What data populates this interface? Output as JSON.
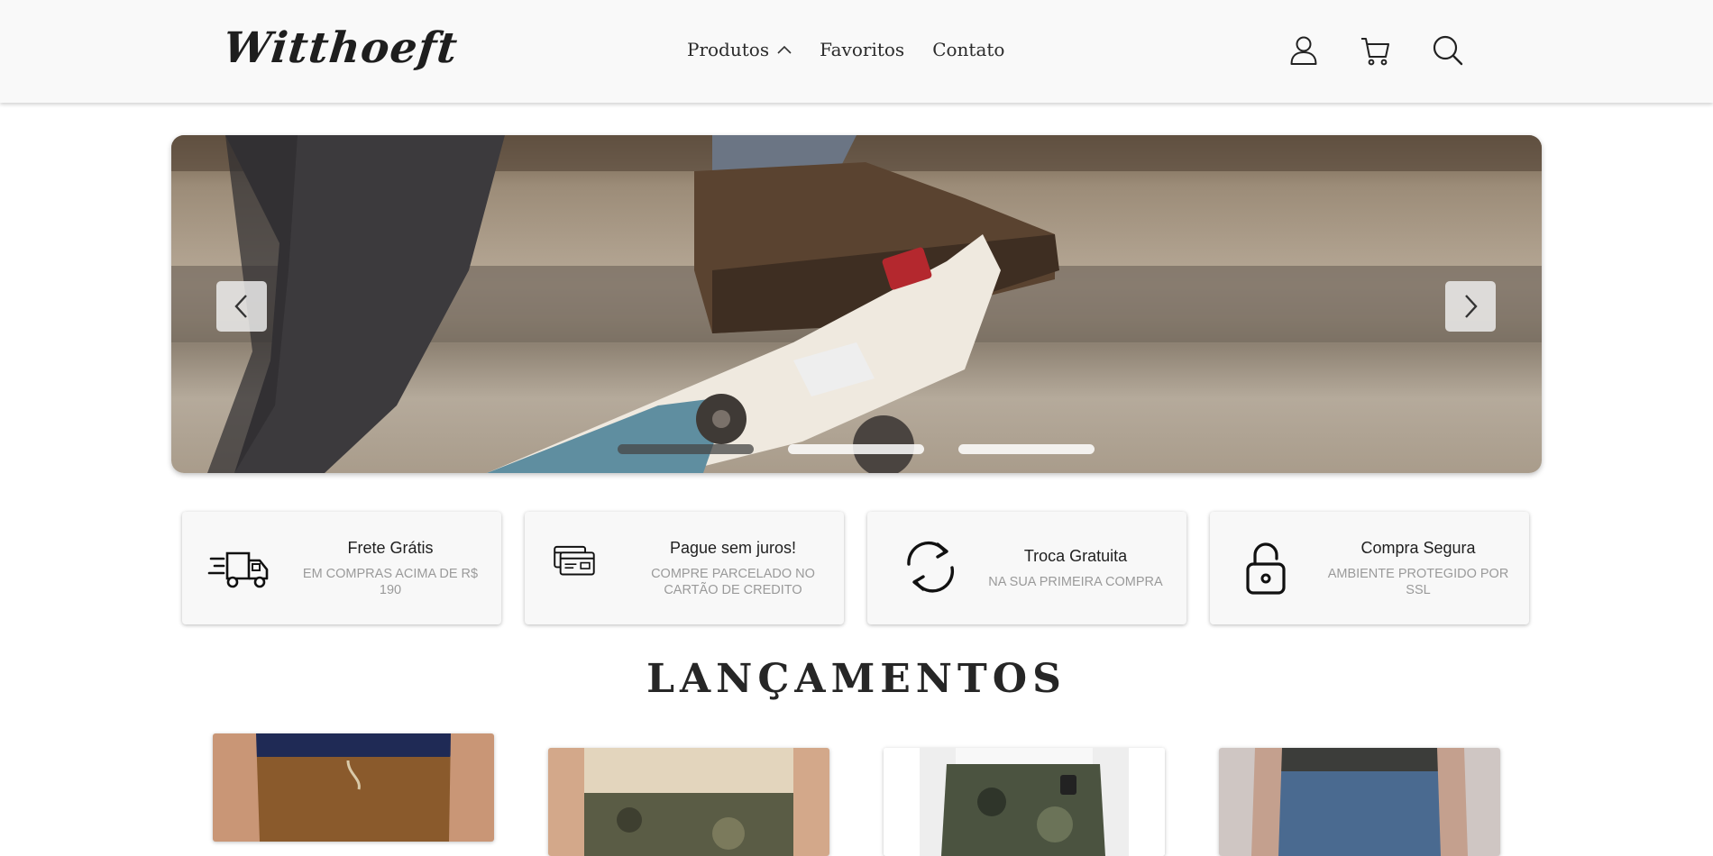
{
  "header": {
    "logo": "Witthoeft",
    "nav": [
      {
        "label": "Produtos",
        "icon": "chevron-up-icon"
      },
      {
        "label": "Favoritos"
      },
      {
        "label": "Contato"
      }
    ],
    "icons": [
      "user-icon",
      "cart-icon",
      "search-icon"
    ]
  },
  "carousel": {
    "image": "skateboarder-photo",
    "prev_icon": "chevron-left-icon",
    "next_icon": "chevron-right-icon",
    "indicator_count": 3,
    "active_index": 0
  },
  "features": [
    {
      "icon": "delivery-truck-icon",
      "title": "Frete Grátis",
      "subtitle": "EM COMPRAS ACIMA DE R$ 190"
    },
    {
      "icon": "credit-card-icon",
      "title": "Pague sem juros!",
      "subtitle": "COMPRE PARCELADO NO CARTÃO DE CREDITO"
    },
    {
      "icon": "refresh-icon",
      "title": "Troca Gratuita",
      "subtitle": "NA SUA PRIMEIRA COMPRA"
    },
    {
      "icon": "padlock-icon",
      "title": "Compra Segura",
      "subtitle": "AMBIENTE PROTEGIDO POR SSL"
    }
  ],
  "section": {
    "title": "LANÇAMENTOS"
  },
  "products": [
    {
      "image": "product-photo-brown-pants"
    },
    {
      "image": "product-photo-camo-shorts"
    },
    {
      "image": "product-photo-camo-pants"
    },
    {
      "image": "product-photo-jeans"
    }
  ],
  "colors": {
    "header_bg": "#f9f9f9",
    "text": "#222222",
    "muted": "#9a9a9a"
  }
}
